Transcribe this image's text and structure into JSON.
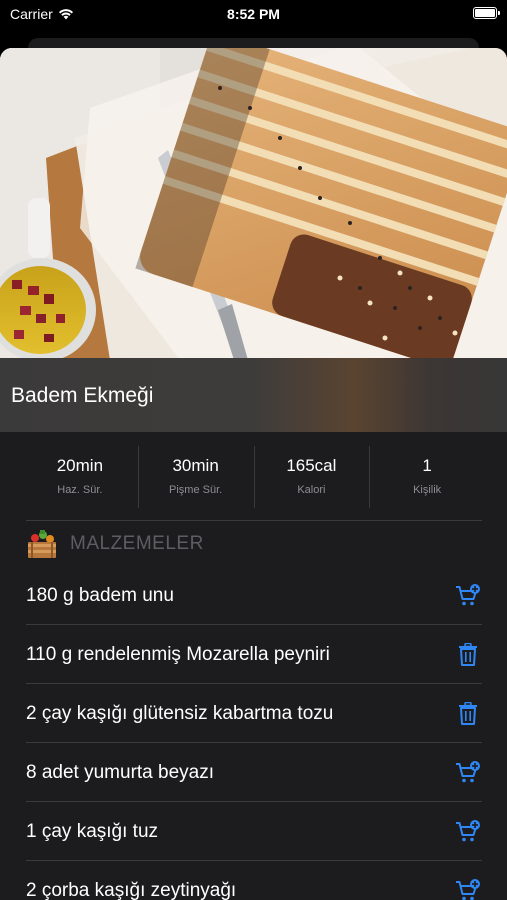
{
  "status_bar": {
    "carrier": "Carrier",
    "time": "8:52 PM"
  },
  "recipe": {
    "title": "Badem Ekmeği"
  },
  "stats": [
    {
      "value": "20min",
      "label": "Haz. Sür."
    },
    {
      "value": "30min",
      "label": "Pişme Sür."
    },
    {
      "value": "165cal",
      "label": "Kalori"
    },
    {
      "value": "1",
      "label": "Kişilik"
    }
  ],
  "ingredients_section": {
    "title": "MALZEMELER",
    "items": [
      {
        "text": "180 g badem unu",
        "action": "cart-add-icon"
      },
      {
        "text": "110 g rendelenmiş Mozarella peyniri",
        "action": "trash-icon"
      },
      {
        "text": "2 çay kaşığı glütensiz kabartma tozu",
        "action": "trash-icon"
      },
      {
        "text": "8 adet yumurta beyazı",
        "action": "cart-add-icon"
      },
      {
        "text": "1 çay kaşığı tuz",
        "action": "cart-add-icon"
      },
      {
        "text": "2 çorba kaşığı zeytinyağı",
        "action": "cart-add-icon"
      }
    ]
  },
  "colors": {
    "accent": "#2f87f5",
    "background": "#1c1c1e",
    "separator": "#3a3a3c",
    "muted": "#8e8e93"
  }
}
